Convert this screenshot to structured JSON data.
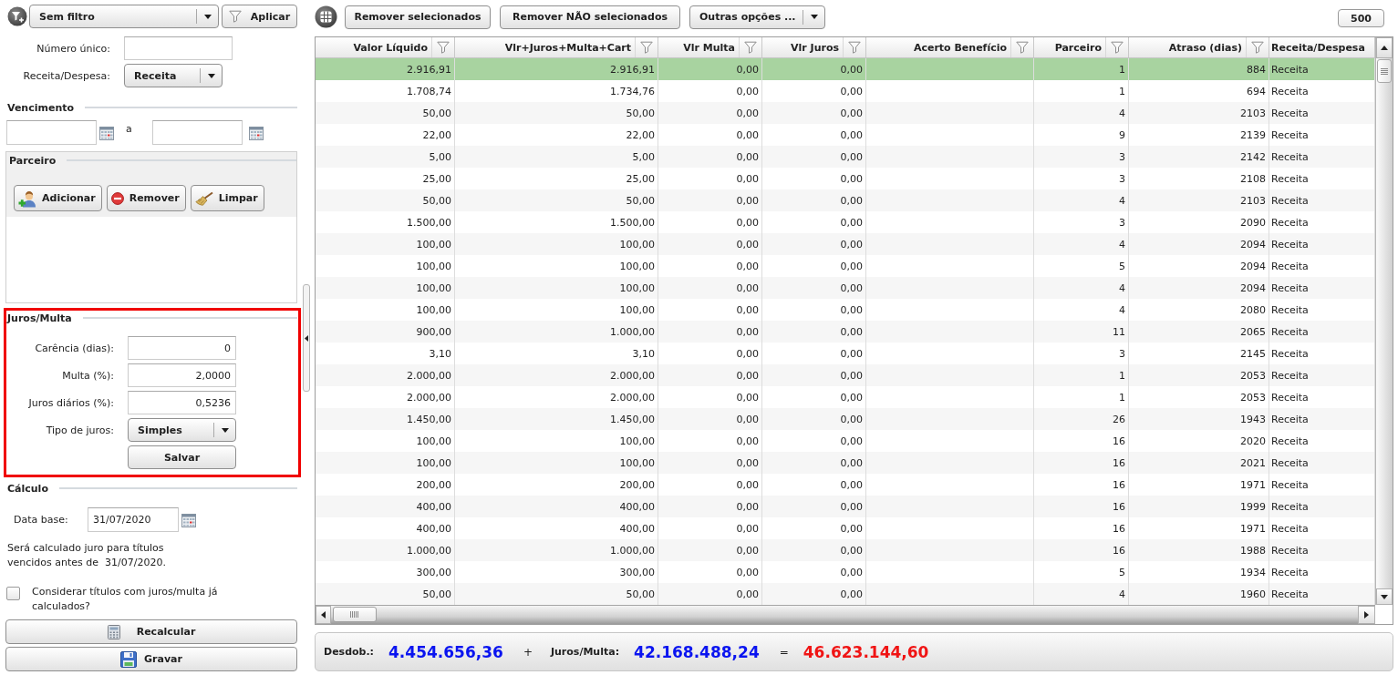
{
  "filter_bar": {
    "filter_dropdown": "Sem filtro",
    "apply_button": "Aplicar"
  },
  "filters": [
    {
      "kind": "input",
      "label": "Número único:"
    },
    {
      "kind": "dropdown",
      "label": "Receita/Despesa:",
      "value": "Receita"
    }
  ],
  "vencimento": {
    "title": "Vencimento",
    "separator": "a"
  },
  "parceiro": {
    "title": "Parceiro",
    "buttons": [
      {
        "kind": "add",
        "label": "Adicionar"
      },
      {
        "kind": "remove",
        "label": "Remover"
      },
      {
        "kind": "clear",
        "label": "Limpar"
      }
    ]
  },
  "juros_multa": {
    "title": "Juros/Multa",
    "highlighted": true,
    "fields": [
      {
        "kind": "input",
        "label": "Carência (dias):",
        "value": "0"
      },
      {
        "kind": "input",
        "label": "Multa (%):",
        "value": "2,0000"
      },
      {
        "kind": "input",
        "label": "Juros diários (%):",
        "value": "0,5236"
      },
      {
        "kind": "dropdown",
        "label": "Tipo de juros:",
        "value": "Simples"
      }
    ],
    "save_button": "Salvar"
  },
  "calculo": {
    "title": "Cálculo",
    "date_label": "Data base:",
    "date_value": "31/07/2020",
    "note": "Será calculado juro para títulos vencidos antes de  31/07/2020.",
    "checkbox": {
      "label": "Considerar títulos com juros/multa já calculados?",
      "checked": false
    }
  },
  "actions": [
    {
      "kind": "calculator",
      "label": "Recalcular"
    },
    {
      "kind": "save",
      "label": "Gravar"
    }
  ],
  "toolbar": {
    "buttons": [
      {
        "kind": "button",
        "label": "Remover selecionados"
      },
      {
        "kind": "button",
        "label": "Remover NÃO selecionados"
      },
      {
        "kind": "dropdown",
        "label": "Outras opções ..."
      }
    ],
    "page_size": "500"
  },
  "table": {
    "columns": [
      {
        "label": "Valor Líquido",
        "kind": "number",
        "filterable": true
      },
      {
        "label": "Vlr+Juros+Multa+Cart",
        "kind": "number",
        "filterable": true
      },
      {
        "label": "Vlr Multa",
        "kind": "number",
        "filterable": true
      },
      {
        "label": "Vlr Juros",
        "kind": "number",
        "filterable": true
      },
      {
        "label": "Acerto Benefício",
        "kind": "number",
        "filterable": true
      },
      {
        "label": "Parceiro",
        "kind": "number",
        "filterable": true
      },
      {
        "label": "Atraso (dias)",
        "kind": "number",
        "filterable": true
      },
      {
        "label": "Receita/Despesa",
        "kind": "text",
        "filterable": false
      }
    ],
    "rows": [
      {
        "selected": true,
        "valor_liquido": "2.916,91",
        "vlr_total": "2.916,91",
        "vlr_multa": "0,00",
        "vlr_juros": "0,00",
        "parceiro": "1",
        "atraso_dias": "884",
        "receita_despesa": "Receita"
      },
      {
        "selected": false,
        "valor_liquido": "1.708,74",
        "vlr_total": "1.734,76",
        "vlr_multa": "0,00",
        "vlr_juros": "0,00",
        "parceiro": "1",
        "atraso_dias": "694",
        "receita_despesa": "Receita"
      },
      {
        "selected": false,
        "valor_liquido": "50,00",
        "vlr_total": "50,00",
        "vlr_multa": "0,00",
        "vlr_juros": "0,00",
        "parceiro": "4",
        "atraso_dias": "2103",
        "receita_despesa": "Receita"
      },
      {
        "selected": false,
        "valor_liquido": "22,00",
        "vlr_total": "22,00",
        "vlr_multa": "0,00",
        "vlr_juros": "0,00",
        "parceiro": "9",
        "atraso_dias": "2139",
        "receita_despesa": "Receita"
      },
      {
        "selected": false,
        "valor_liquido": "5,00",
        "vlr_total": "5,00",
        "vlr_multa": "0,00",
        "vlr_juros": "0,00",
        "parceiro": "3",
        "atraso_dias": "2142",
        "receita_despesa": "Receita"
      },
      {
        "selected": false,
        "valor_liquido": "25,00",
        "vlr_total": "25,00",
        "vlr_multa": "0,00",
        "vlr_juros": "0,00",
        "parceiro": "3",
        "atraso_dias": "2108",
        "receita_despesa": "Receita"
      },
      {
        "selected": false,
        "valor_liquido": "50,00",
        "vlr_total": "50,00",
        "vlr_multa": "0,00",
        "vlr_juros": "0,00",
        "parceiro": "4",
        "atraso_dias": "2103",
        "receita_despesa": "Receita"
      },
      {
        "selected": false,
        "valor_liquido": "1.500,00",
        "vlr_total": "1.500,00",
        "vlr_multa": "0,00",
        "vlr_juros": "0,00",
        "parceiro": "3",
        "atraso_dias": "2090",
        "receita_despesa": "Receita"
      },
      {
        "selected": false,
        "valor_liquido": "100,00",
        "vlr_total": "100,00",
        "vlr_multa": "0,00",
        "vlr_juros": "0,00",
        "parceiro": "4",
        "atraso_dias": "2094",
        "receita_despesa": "Receita"
      },
      {
        "selected": false,
        "valor_liquido": "100,00",
        "vlr_total": "100,00",
        "vlr_multa": "0,00",
        "vlr_juros": "0,00",
        "parceiro": "5",
        "atraso_dias": "2094",
        "receita_despesa": "Receita"
      },
      {
        "selected": false,
        "valor_liquido": "100,00",
        "vlr_total": "100,00",
        "vlr_multa": "0,00",
        "vlr_juros": "0,00",
        "parceiro": "4",
        "atraso_dias": "2094",
        "receita_despesa": "Receita"
      },
      {
        "selected": false,
        "valor_liquido": "100,00",
        "vlr_total": "100,00",
        "vlr_multa": "0,00",
        "vlr_juros": "0,00",
        "parceiro": "4",
        "atraso_dias": "2080",
        "receita_despesa": "Receita"
      },
      {
        "selected": false,
        "valor_liquido": "900,00",
        "vlr_total": "1.000,00",
        "vlr_multa": "0,00",
        "vlr_juros": "0,00",
        "parceiro": "11",
        "atraso_dias": "2065",
        "receita_despesa": "Receita"
      },
      {
        "selected": false,
        "valor_liquido": "3,10",
        "vlr_total": "3,10",
        "vlr_multa": "0,00",
        "vlr_juros": "0,00",
        "parceiro": "3",
        "atraso_dias": "2145",
        "receita_despesa": "Receita"
      },
      {
        "selected": false,
        "valor_liquido": "2.000,00",
        "vlr_total": "2.000,00",
        "vlr_multa": "0,00",
        "vlr_juros": "0,00",
        "parceiro": "1",
        "atraso_dias": "2053",
        "receita_despesa": "Receita"
      },
      {
        "selected": false,
        "valor_liquido": "2.000,00",
        "vlr_total": "2.000,00",
        "vlr_multa": "0,00",
        "vlr_juros": "0,00",
        "parceiro": "1",
        "atraso_dias": "2053",
        "receita_despesa": "Receita"
      },
      {
        "selected": false,
        "valor_liquido": "1.450,00",
        "vlr_total": "1.450,00",
        "vlr_multa": "0,00",
        "vlr_juros": "0,00",
        "parceiro": "26",
        "atraso_dias": "1943",
        "receita_despesa": "Receita"
      },
      {
        "selected": false,
        "valor_liquido": "100,00",
        "vlr_total": "100,00",
        "vlr_multa": "0,00",
        "vlr_juros": "0,00",
        "parceiro": "16",
        "atraso_dias": "2020",
        "receita_despesa": "Receita"
      },
      {
        "selected": false,
        "valor_liquido": "100,00",
        "vlr_total": "100,00",
        "vlr_multa": "0,00",
        "vlr_juros": "0,00",
        "parceiro": "16",
        "atraso_dias": "2021",
        "receita_despesa": "Receita"
      },
      {
        "selected": false,
        "valor_liquido": "200,00",
        "vlr_total": "200,00",
        "vlr_multa": "0,00",
        "vlr_juros": "0,00",
        "parceiro": "16",
        "atraso_dias": "1971",
        "receita_despesa": "Receita"
      },
      {
        "selected": false,
        "valor_liquido": "400,00",
        "vlr_total": "400,00",
        "vlr_multa": "0,00",
        "vlr_juros": "0,00",
        "parceiro": "16",
        "atraso_dias": "1999",
        "receita_despesa": "Receita"
      },
      {
        "selected": false,
        "valor_liquido": "400,00",
        "vlr_total": "400,00",
        "vlr_multa": "0,00",
        "vlr_juros": "0,00",
        "parceiro": "16",
        "atraso_dias": "1971",
        "receita_despesa": "Receita"
      },
      {
        "selected": false,
        "valor_liquido": "1.000,00",
        "vlr_total": "1.000,00",
        "vlr_multa": "0,00",
        "vlr_juros": "0,00",
        "parceiro": "16",
        "atraso_dias": "1988",
        "receita_despesa": "Receita"
      },
      {
        "selected": false,
        "valor_liquido": "300,00",
        "vlr_total": "300,00",
        "vlr_multa": "0,00",
        "vlr_juros": "0,00",
        "parceiro": "5",
        "atraso_dias": "1934",
        "receita_despesa": "Receita"
      },
      {
        "selected": false,
        "valor_liquido": "50,00",
        "vlr_total": "50,00",
        "vlr_multa": "0,00",
        "vlr_juros": "0,00",
        "parceiro": "4",
        "atraso_dias": "1960",
        "receita_despesa": "Receita"
      }
    ]
  },
  "summary": [
    {
      "kind": "label",
      "text": "Desdob.:"
    },
    {
      "kind": "value",
      "text": "4.454.656,36",
      "color": "#0a14f0"
    },
    {
      "kind": "operator",
      "text": "+"
    },
    {
      "kind": "label",
      "text": "Juros/Multa:"
    },
    {
      "kind": "value",
      "text": "42.168.488,24",
      "color": "#0a14f0"
    },
    {
      "kind": "operator",
      "text": "="
    },
    {
      "kind": "value",
      "text": "46.623.144,60",
      "color": "#f01414"
    }
  ]
}
